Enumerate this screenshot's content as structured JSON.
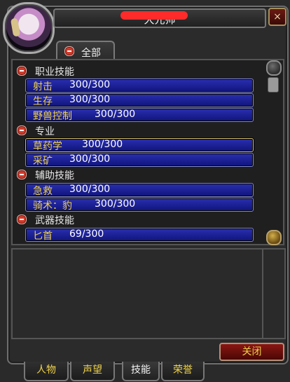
{
  "window": {
    "title": "大元帅",
    "close_icon": "×",
    "portrait_name": "portrait-elf"
  },
  "filter_tab": {
    "label": "全部"
  },
  "categories": [
    {
      "label": "职业技能",
      "skills": [
        {
          "name": "射击",
          "value": "300/300"
        },
        {
          "name": "生存",
          "value": "300/300"
        },
        {
          "name": "野兽控制",
          "value": "300/300"
        }
      ]
    },
    {
      "label": "专业",
      "skills": [
        {
          "name": "草药学",
          "value": "300/300",
          "selected": true
        },
        {
          "name": "采矿",
          "value": "300/300"
        }
      ]
    },
    {
      "label": "辅助技能",
      "skills": [
        {
          "name": "急救",
          "value": "300/300"
        },
        {
          "name": "骑术：豹",
          "value": "300/300"
        }
      ]
    },
    {
      "label": "武器技能",
      "skills": [
        {
          "name": "匕首",
          "value": "69/300"
        }
      ]
    }
  ],
  "buttons": {
    "close_label": "关闭"
  },
  "tabs": [
    {
      "label": "人物",
      "active": false
    },
    {
      "label": "声望",
      "active": false
    },
    {
      "label": "技能",
      "active": true
    },
    {
      "label": "荣誉",
      "active": false
    }
  ],
  "colors": {
    "skill_name": "#f0d24a",
    "skill_value": "#ffffff",
    "skill_bar": "#1b20a0",
    "close_button": "#8a1712"
  }
}
